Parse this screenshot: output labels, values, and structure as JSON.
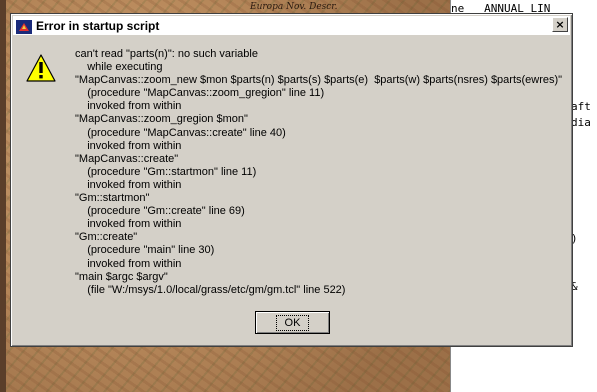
{
  "dialog": {
    "title": "Error in startup script",
    "close_label": "×",
    "icon": "warning-icon",
    "ok_label": "OK",
    "message_lines": [
      "can't read \"parts(n)\": no such variable",
      "    while executing",
      "\"MapCanvas::zoom_new $mon $parts(n) $parts(s) $parts(e)  $parts(w) $parts(nsres) $parts(ewres)\"",
      "    (procedure \"MapCanvas::zoom_gregion\" line 11)",
      "    invoked from within",
      "\"MapCanvas::zoom_gregion $mon\"",
      "    (procedure \"MapCanvas::create\" line 40)",
      "    invoked from within",
      "\"MapCanvas::create\"",
      "    (procedure \"Gm::startmon\" line 11)",
      "    invoked from within",
      "\"Gm::startmon\"",
      "    (procedure \"Gm::create\" line 69)",
      "    invoked from within",
      "\"Gm::create\"",
      "    (procedure \"main\" line 30)",
      "    invoked from within",
      "\"main $argc $argv\"",
      "    (file \"W:/msys/1.0/local/grass/etc/gm/gm.tcl\" line 522)"
    ]
  },
  "background": {
    "map_title": "Europa Nov. Descr.",
    "editor_fragments": [
      "aft",
      "dia",
      ")",
      "&"
    ]
  },
  "colors": {
    "dialog_face": "#d4d0c8",
    "titlebar": "#ffffff",
    "warning_yellow": "#ffff00"
  }
}
